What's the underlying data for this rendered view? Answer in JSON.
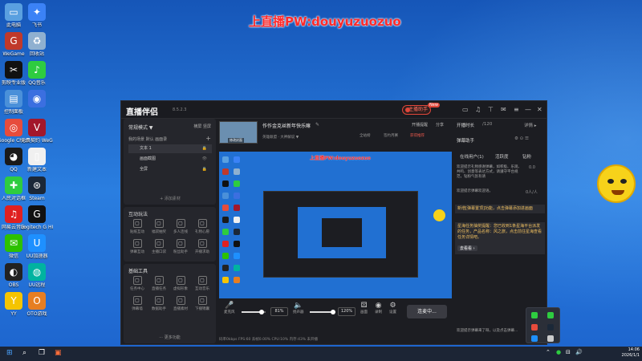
{
  "overlay_title": "上直播PW:douyuzuozuo",
  "desktop_icons": [
    {
      "label": "此电脑",
      "icon": "computer-icon",
      "color": "#5aa0e0"
    },
    {
      "label": "飞书",
      "icon": "feishu-icon",
      "color": "#3b82f6"
    },
    {
      "label": "WeGame",
      "icon": "wegame-icon",
      "color": "#c0392b"
    },
    {
      "label": "回收站",
      "icon": "recycle-bin-icon",
      "color": "#8fb0d0"
    },
    {
      "label": "剪映专业版",
      "icon": "capcut-icon",
      "color": "#111111"
    },
    {
      "label": "QQ音乐",
      "icon": "qqmusic-icon",
      "color": "#2ecc40"
    },
    {
      "label": "控制面板",
      "icon": "control-panel-icon",
      "color": "#4a90d9"
    },
    {
      "label": "",
      "icon": "browser-icon",
      "color": "#3b6fe0"
    },
    {
      "label": "Google Chrome",
      "icon": "chrome-icon",
      "color": "#e74c3c"
    },
    {
      "label": "无畏契约 WeGame版",
      "icon": "valorant-icon",
      "color": "#a3172b"
    },
    {
      "label": "QQ",
      "icon": "qq-icon",
      "color": "#1a1a1a"
    },
    {
      "label": "新建文本",
      "icon": "text-file-icon",
      "color": "#f0f0f0"
    },
    {
      "label": "人民对话框",
      "icon": "gift-icon",
      "color": "#2ecc40"
    },
    {
      "label": "Steam",
      "icon": "steam-icon",
      "color": "#1b2838"
    },
    {
      "label": "网易云音乐",
      "icon": "netease-music-icon",
      "color": "#e02020"
    },
    {
      "label": "Logitech G HUB",
      "icon": "logitech-icon",
      "color": "#111111"
    },
    {
      "label": "微信",
      "icon": "wechat-icon",
      "color": "#2dc100"
    },
    {
      "label": "UU加速器",
      "icon": "uu-icon",
      "color": "#1e90ff"
    },
    {
      "label": "OBS",
      "icon": "obs-icon",
      "color": "#222222"
    },
    {
      "label": "UU远程",
      "icon": "uu-remote-icon",
      "color": "#00b3a0"
    },
    {
      "label": "YY",
      "icon": "yy-icon",
      "color": "#f5c400"
    },
    {
      "label": "OTO游戏",
      "icon": "oto-icon",
      "color": "#e67e22"
    }
  ],
  "app": {
    "name": "直播伴侣",
    "version": "8.5.2.3",
    "live_status": "主播助手",
    "new_badge": "New",
    "left": {
      "mode": "常规模式 ▼",
      "mode_right": "横屏  竖屏",
      "scenes_header": "我的场景   默认   画面录",
      "sources": [
        {
          "label": "文本 1",
          "lock": "🔒",
          "selected": true
        },
        {
          "label": "画面截图",
          "lock": "👁",
          "selected": false
        },
        {
          "label": "全屏",
          "lock": "🔒",
          "selected": false
        }
      ],
      "add_source": "+ 添加素材",
      "interact_title": "互动玩法",
      "interact_tools": [
        "贴纸互动",
        "福袋抽奖",
        "多人连线",
        "礼物心愿",
        "弹幕互动",
        "主播口袋",
        "粉丝助手",
        "开播求助"
      ],
      "basic_title": "基础工具",
      "basic_tools": [
        "任务中心",
        "直播任务",
        "虚拟形象",
        "互动音乐",
        "弹幕墙",
        "数据助手",
        "直播素材",
        "下播锦囊"
      ],
      "more": "⋯ 更多功能"
    },
    "center": {
      "thumb_label": "修改封面",
      "title": "作作金克丝新年快乐嘛",
      "tags": "英雄联盟 · 大神解说 ▼",
      "right_top": [
        "开播提醒",
        "分享"
      ],
      "right_sub": [
        "全站榜",
        "签约月赛",
        "获得推荐"
      ],
      "preview_title": "上直播PW:douyuzuozuo",
      "mic_label": "麦克风",
      "mic_pct": "81%",
      "speaker_label": "扬声器",
      "speaker_pct": "120%",
      "tools": [
        "画面",
        "录制",
        "设置"
      ],
      "connect": "连麦中...",
      "status": "码率0kbps   FPS:60   丢帧0.00%   CPU:10%   内存:43%   未开播"
    },
    "right": {
      "header_left": "开播时长",
      "header_mid": "/120",
      "header_right": "详情 ▸",
      "assistant": "弹幕助手",
      "tabs": [
        "在线用户(1)",
        "活跃度",
        "钻粉"
      ],
      "msg1": "欢迎提示礼物感谢弹幕，如积极、乐观、共鸣、创意等表达方式，请遵守平台规范，钻粉气氛有请",
      "msg2": "欢迎提示弹幕欢迎语。",
      "count1": "0.0",
      "count2": "0人/人",
      "hl1": "新增[弹幕置顶]功能，点击弹幕添加进画面",
      "hl2": "星海任务抽奖提醒：您已收到1条星海平台派发的任务，产品名称：风之旅，点击前往星海查看任务详情吧。",
      "hl_btn": "去看看 ›",
      "footer": "欢迎提示弹幕来了呀，以及点击弹幕..."
    }
  },
  "taskbar": {
    "time": "14:06",
    "date": "2026/1/1"
  }
}
